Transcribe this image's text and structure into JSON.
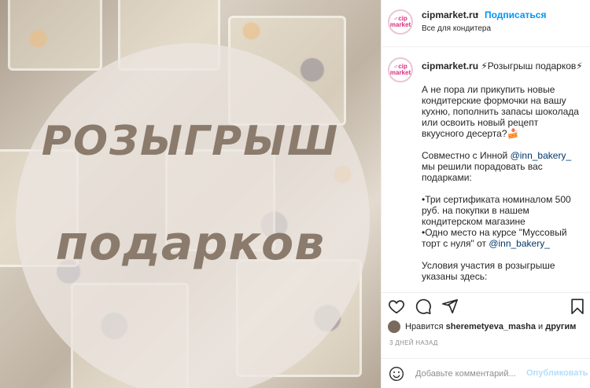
{
  "photo": {
    "line1": "РОЗЫГРЫШ",
    "line2": "подарков"
  },
  "logo": {
    "line1": "♂cip",
    "line2": "market"
  },
  "header": {
    "username": "cipmarket.ru",
    "dot": "•",
    "follow_label": "Подписаться",
    "subtitle": "Все для кондитера"
  },
  "caption": {
    "username": "cipmarket.ru",
    "title": "⚡Розыгрыш подарков⚡",
    "text": "А не пора ли прикупить новые кондитерские формочки на вашу кухню, пополнить запасы шоколада или освоить новый рецепт вкуусного десерта?🍰\n\nСовместно с Инной ",
    "mention1": "@inn_bakery_",
    "text2": "\nмы решили порадовать вас подарками:\n\n•Три сертификата номиналом 500 руб. на покупки в нашем кондитерском магазине\n•Одно место на курсе \"Муссовый торт с нуля\" от ",
    "mention2": "@inn_bakery_",
    "text3": "\n\nУсловия участия в розыгрыше указаны здесь:"
  },
  "likes": {
    "prefix": "Нравится",
    "user": "sheremetyeva_masha",
    "middle": "и",
    "others": "другим"
  },
  "date": "3 ДНЕЙ НАЗАД",
  "comment": {
    "placeholder": "Добавьте комментарий...",
    "publish_label": "Опубликовать"
  },
  "colors": {
    "accent_blue": "#0095f6",
    "publish_disabled": "#b2dffc",
    "headline_text": "#8a7b6c",
    "logo_pink": "#d4317e"
  },
  "icons": [
    "heart-icon",
    "comment-icon",
    "share-icon",
    "bookmark-icon",
    "smile-icon"
  ]
}
